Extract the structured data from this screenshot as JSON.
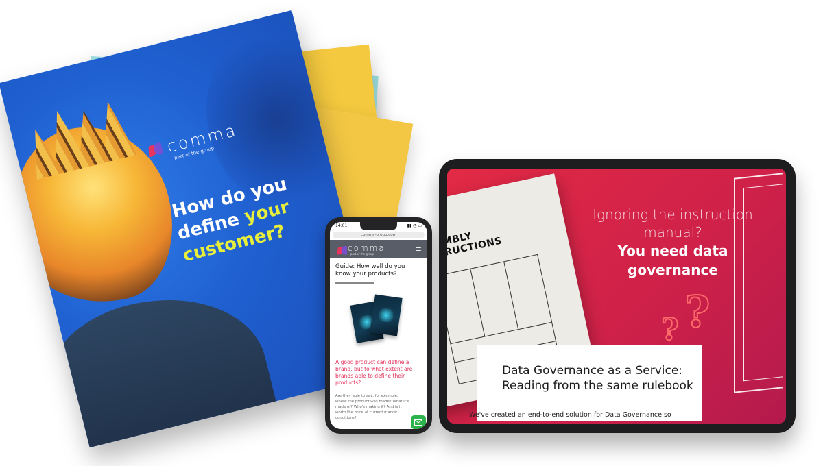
{
  "brochure": {
    "logo_word": "comma",
    "logo_tagline": "part of the group",
    "title_line1": "How do you",
    "title_line2": "define",
    "title_highlight": "your",
    "title_line3": "customer?"
  },
  "phone": {
    "time": "14:01",
    "url": "comma-group.com",
    "logo_word": "comma",
    "logo_tagline": "part of the group",
    "heading": "Guide: How well do you know your products?",
    "lead": "A good product can define a brand, but to what extent are brands able to define their products?",
    "body": "Are they able to say, for example, where the product was made? What it's made of? Who's making it? And is it worth the price at current market conditions?"
  },
  "tablet": {
    "manual_heading_line1": "EMBLY",
    "manual_heading_line2": "TRUCTIONS",
    "headline_light": "Ignoring the instruction manual?",
    "headline_bold": "You need data governance",
    "card_title": "Data Governance as a Service: Reading from the same rulebook",
    "card_body": "We've created an end-to-end solution for Data Governance so"
  },
  "colors": {
    "brochure_blue": "#1f5fcf",
    "highlight_yellow": "#e8ef3a",
    "tablet_red": "#d8233f",
    "phone_pink": "#e2305a",
    "mail_green": "#2bb24a"
  },
  "icons": [
    "comma-logo-icon",
    "hamburger-menu-icon",
    "mail-icon"
  ]
}
